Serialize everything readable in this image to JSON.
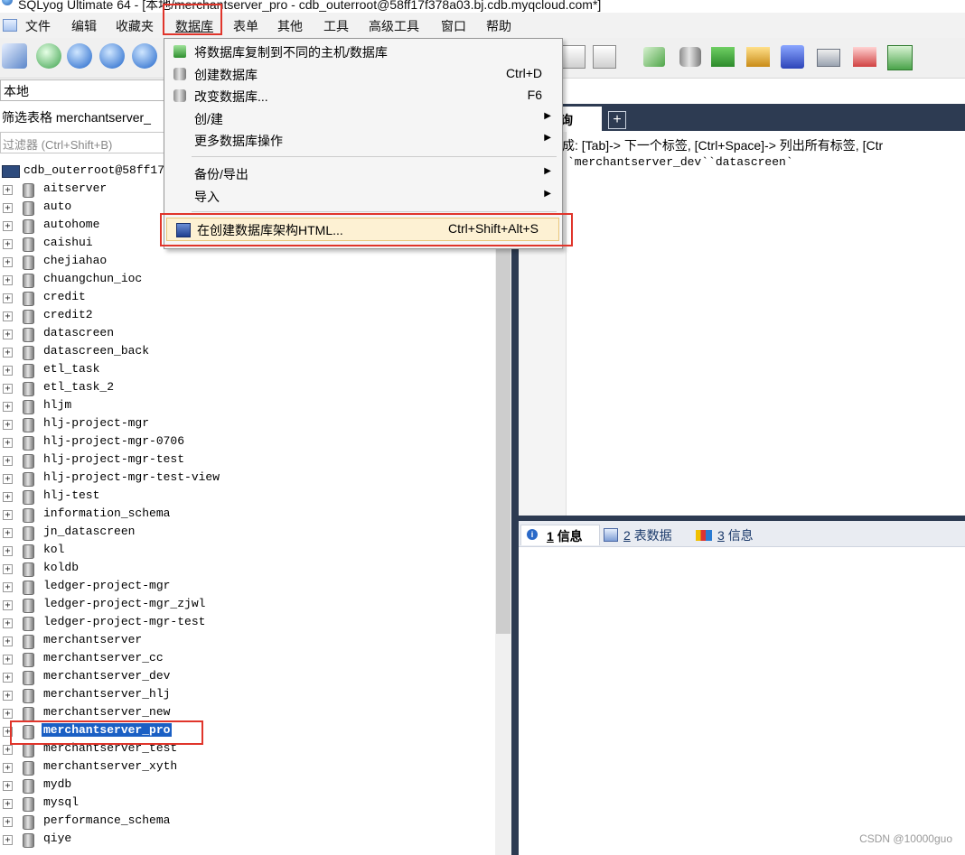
{
  "window": {
    "title": "SQLyog Ultimate 64 - [本地/merchantserver_pro - cdb_outerroot@58ff17f378a03.bj.cdb.myqcloud.com*]"
  },
  "menubar": {
    "items": [
      "文件",
      "编辑",
      "收藏夹",
      "数据库",
      "表单",
      "其他",
      "工具",
      "高级工具",
      "窗口",
      "帮助"
    ],
    "open_menu": "数据库"
  },
  "dropdown": {
    "items": [
      {
        "label": "将数据库复制到不同的主机/数据库",
        "shortcut": "",
        "submenu": false
      },
      {
        "label": "创建数据库",
        "shortcut": "Ctrl+D",
        "submenu": false
      },
      {
        "label": "改变数据库...",
        "shortcut": "F6",
        "submenu": false
      },
      {
        "label": "创/建",
        "shortcut": "",
        "submenu": true
      },
      {
        "label": "更多数据库操作",
        "shortcut": "",
        "submenu": true
      },
      {
        "label": "备份/导出",
        "shortcut": "",
        "submenu": true
      },
      {
        "label": "导入",
        "shortcut": "",
        "submenu": true
      },
      {
        "label": "在创建数据库架构HTML...",
        "shortcut": "Ctrl+Shift+Alt+S",
        "submenu": false,
        "highlighted": true
      }
    ]
  },
  "left_panel": {
    "connection": "本地",
    "filter_label": "筛选表格 merchantserver_",
    "filter_placeholder": "过滤器 (Ctrl+Shift+B)",
    "root": "cdb_outerroot@58ff17f",
    "databases": [
      "aitserver",
      "auto",
      "autohome",
      "caishui",
      "chejiahao",
      "chuangchun_ioc",
      "credit",
      "credit2",
      "datascreen",
      "datascreen_back",
      "etl_task",
      "etl_task_2",
      "hljm",
      "hlj-project-mgr",
      "hlj-project-mgr-0706",
      "hlj-project-mgr-test",
      "hlj-project-mgr-test-view",
      "hlj-test",
      "information_schema",
      "jn_datascreen",
      "kol",
      "koldb",
      "ledger-project-mgr",
      "ledger-project-mgr_zjwl",
      "ledger-project-mgr-test",
      "merchantserver",
      "merchantserver_cc",
      "merchantserver_dev",
      "merchantserver_hlj",
      "merchantserver_new",
      "merchantserver_pro",
      "merchantserver_test",
      "merchantserver_xyth",
      "mydb",
      "mysql",
      "performance_schema",
      "qiye"
    ],
    "selected": "merchantserver_pro"
  },
  "editor": {
    "tab_label": "询",
    "add_tab": "+",
    "hint": "成: [Tab]-> 下一个标签, [Ctrl+Space]-> 列出所有标签, [Ctr",
    "code": "`merchantserver_dev``datascreen`"
  },
  "result_tabs": [
    {
      "num": "1",
      "label": "信息"
    },
    {
      "num": "2",
      "label": "表数据"
    },
    {
      "num": "3",
      "label": "信息"
    }
  ],
  "watermark": "CSDN @10000guo",
  "colors": {
    "panel_dark": "#2d3b52",
    "selection": "#1a5fc4",
    "annotation_red": "#e0352b"
  }
}
